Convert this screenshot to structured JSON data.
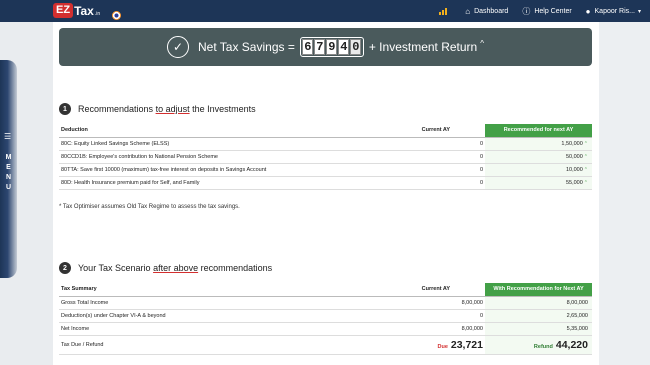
{
  "nav": {
    "logo_ez": "EZ",
    "logo_tax": "Tax",
    "logo_suffix": ".in",
    "dashboard": "Dashboard",
    "help_center": "Help Center",
    "user": "Kapoor Ris...",
    "accent": "#f2b01e",
    "bg": "#1d3557"
  },
  "side_menu": {
    "label": "MENU"
  },
  "banner": {
    "prefix": "Net Tax Savings =",
    "digits": [
      "6",
      "7",
      "9",
      "4",
      "0"
    ],
    "suffix": "+ Investment Return",
    "caret": "^"
  },
  "section1": {
    "number": "1",
    "title_before": "Recommendations",
    "title_link": "to adjust",
    "title_after": "the Investments",
    "columns": [
      "Deduction",
      "Current AY",
      "Recommended for next AY"
    ],
    "rows": [
      {
        "deduction": "80C: Equity Linked Savings Scheme (ELSS)",
        "current": "0",
        "recommended": "1,50,000"
      },
      {
        "deduction": "80CCD1B: Employee's contribution to National Pension Scheme",
        "current": "0",
        "recommended": "50,000"
      },
      {
        "deduction": "80TTA: Save first 10000 (maximum) tax-free interest on deposits in Savings Account",
        "current": "0",
        "recommended": "10,000"
      },
      {
        "deduction": "80D: Health Insurance premium paid for Self, and Family",
        "current": "0",
        "recommended": "55,000"
      }
    ],
    "note": "* Tax Optimiser assumes Old Tax Regime to assess the tax savings."
  },
  "section2": {
    "number": "2",
    "title_before": "Your Tax Scenario",
    "title_link": "after above",
    "title_after": "recommendations",
    "columns": [
      "Tax Summary",
      "Current AY",
      "With Recommendation for Next AY"
    ],
    "rows": [
      {
        "label": "Gross Total Income",
        "current": "8,00,000",
        "recommended": "8,00,000"
      },
      {
        "label": "Deduction(s) under Chapter VI-A & beyond",
        "current": "0",
        "recommended": "2,65,000"
      },
      {
        "label": "Net Income",
        "current": "8,00,000",
        "recommended": "5,35,000"
      }
    ],
    "final": {
      "label": "Tax Due / Refund",
      "current_tag": "Due",
      "current_value": "23,721",
      "recommended_tag": "Refund",
      "recommended_value": "44,220"
    }
  },
  "colors": {
    "green_header": "#43a047",
    "due_red": "#d32f2f",
    "refund_green": "#2e7d32"
  }
}
